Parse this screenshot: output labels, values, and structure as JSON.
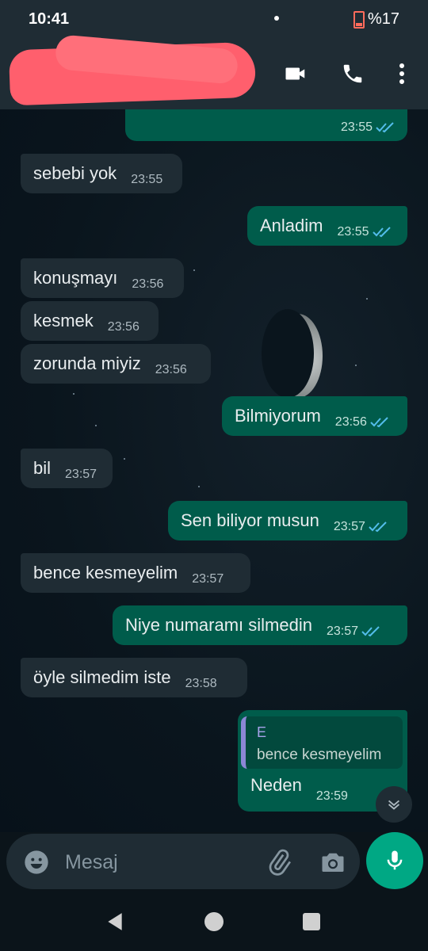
{
  "status_bar": {
    "time": "10:41",
    "battery": "%17"
  },
  "composer": {
    "placeholder": "Mesaj"
  },
  "messages": [
    {
      "side": "out",
      "text": "",
      "time": "23:55"
    },
    {
      "side": "in",
      "text": "sebebi yok",
      "time": "23:55"
    },
    {
      "side": "out",
      "text": "Anladim",
      "time": "23:55"
    },
    {
      "side": "in",
      "text": "konuşmayı",
      "time": "23:56"
    },
    {
      "side": "in",
      "text": "kesmek",
      "time": "23:56"
    },
    {
      "side": "in",
      "text": "zorunda miyiz",
      "time": "23:56"
    },
    {
      "side": "out",
      "text": "Bilmiyorum",
      "time": "23:56"
    },
    {
      "side": "in",
      "text": "bil",
      "time": "23:57"
    },
    {
      "side": "out",
      "text": "Sen biliyor musun",
      "time": "23:57"
    },
    {
      "side": "in",
      "text": "bence kesmeyelim",
      "time": "23:57"
    },
    {
      "side": "out",
      "text": "Niye numaramı silmedin",
      "time": "23:57"
    },
    {
      "side": "in",
      "text": "öyle silmedim iste",
      "time": "23:58"
    },
    {
      "side": "out",
      "text": "Neden",
      "time": "23:59",
      "reply": {
        "name": "E",
        "text": "bence kesmeyelim"
      }
    }
  ],
  "colors": {
    "outgoing": "#005c4b",
    "incoming": "#1f2c34",
    "accent": "#00a884",
    "read_ticks": "#53bdeb"
  },
  "icons": [
    "back-arrow-icon",
    "video-call-icon",
    "phone-icon",
    "more-icon",
    "emoji-icon",
    "attach-icon",
    "camera-icon",
    "mic-icon",
    "scroll-down-icon"
  ]
}
